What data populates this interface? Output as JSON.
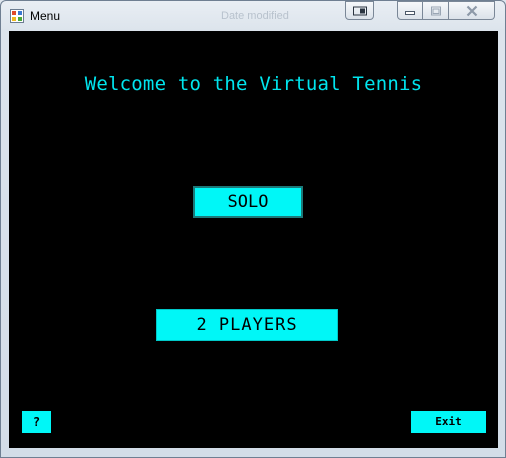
{
  "window": {
    "title": "Menu",
    "background_title": "Date modified"
  },
  "colors": {
    "accent": "#00f7f7",
    "heading": "#00e5ee",
    "background": "#000000"
  },
  "main": {
    "welcome": "Welcome to the Virtual Tennis",
    "solo_label": "SOLO",
    "two_players_label": "2 PLAYERS",
    "help_label": "?",
    "exit_label": "Exit"
  }
}
